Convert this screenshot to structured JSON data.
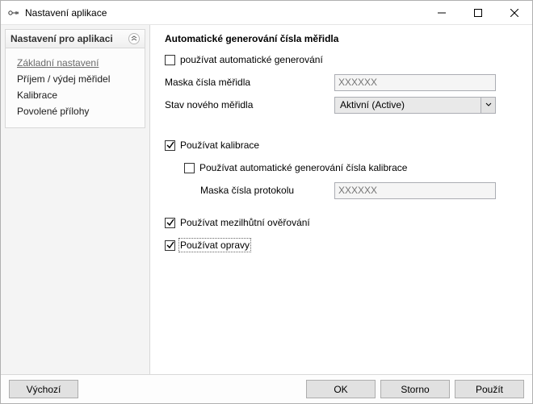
{
  "window": {
    "title": "Nastavení aplikace"
  },
  "sidebar": {
    "header": "Nastavení pro aplikaci",
    "items": [
      {
        "label": "Základní nastavení",
        "active": true
      },
      {
        "label": "Příjem / výdej měřidel"
      },
      {
        "label": "Kalibrace"
      },
      {
        "label": "Povolené přílohy"
      }
    ]
  },
  "content": {
    "section_title": "Automatické generování čísla měřidla",
    "auto_gen_checkbox": "používat automatické generování",
    "mask_label": "Maska čísla měřidla",
    "mask_placeholder": "XXXXXX",
    "state_label": "Stav nového měřidla",
    "state_value": "Aktivní (Active)",
    "use_calibrations": "Používat kalibrace",
    "auto_gen_calib": "Používat automatické generování čísla kalibrace",
    "protocol_mask_label": "Maska čísla protokolu",
    "protocol_mask_placeholder": "XXXXXX",
    "use_interim": "Používat mezilhůtní ověřování",
    "use_repairs": "Používat opravy"
  },
  "footer": {
    "defaults": "Výchozí",
    "ok": "OK",
    "cancel": "Storno",
    "apply": "Použít"
  }
}
